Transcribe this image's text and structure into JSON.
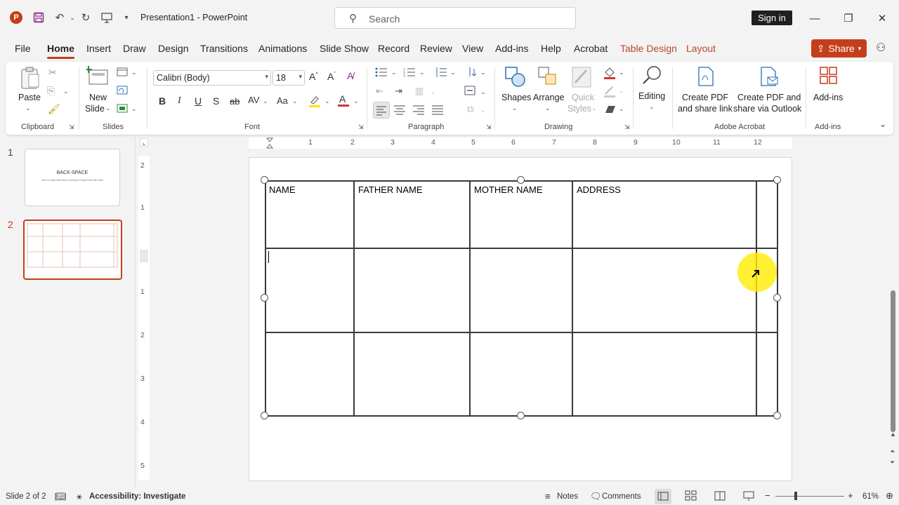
{
  "titlebar": {
    "app_letter": "P",
    "doc_title": "Presentation1  -  PowerPoint",
    "search_placeholder": "Search",
    "signin": "Sign in"
  },
  "tabs": [
    {
      "label": "File"
    },
    {
      "label": "Home"
    },
    {
      "label": "Insert"
    },
    {
      "label": "Draw"
    },
    {
      "label": "Design"
    },
    {
      "label": "Transitions"
    },
    {
      "label": "Animations"
    },
    {
      "label": "Slide Show"
    },
    {
      "label": "Record"
    },
    {
      "label": "Review"
    },
    {
      "label": "View"
    },
    {
      "label": "Add-ins"
    },
    {
      "label": "Help"
    },
    {
      "label": "Acrobat"
    },
    {
      "label": "Table Design"
    },
    {
      "label": "Layout"
    }
  ],
  "share_label": "Share",
  "ribbon": {
    "clipboard": {
      "paste": "Paste",
      "group": "Clipboard"
    },
    "slides": {
      "new_slide_1": "New",
      "new_slide_2": "Slide",
      "group": "Slides"
    },
    "font": {
      "font_name": "Calibri (Body)",
      "font_size": "18",
      "group": "Font",
      "bold": "B",
      "italic": "I",
      "underline": "U",
      "strike": "S",
      "abc": "ab",
      "spacing": "AV",
      "case": "Aa"
    },
    "paragraph": {
      "group": "Paragraph"
    },
    "drawing": {
      "shapes": "Shapes",
      "arrange": "Arrange",
      "quick_styles_1": "Quick",
      "quick_styles_2": "Styles",
      "group": "Drawing"
    },
    "editing": {
      "label": "Editing"
    },
    "acrobat": {
      "create_pdf_1": "Create PDF",
      "create_pdf_2": "and share link",
      "create_outlook_1": "Create PDF and",
      "create_outlook_2": "share via Outlook",
      "group": "Adobe Acrobat"
    },
    "addins": {
      "label": "Add-ins",
      "group": "Add-ins"
    }
  },
  "slides_pane": [
    {
      "number": "1",
      "title": "BACK-SPACE",
      "subtitle": "How to make table lines overlap in PowerPoint with ease"
    },
    {
      "number": "2"
    }
  ],
  "ruler": {
    "h_ticks": [
      "2",
      "1",
      "2",
      "3",
      "4",
      "5",
      "6",
      "7",
      "8",
      "9",
      "10",
      "11",
      "12"
    ],
    "v_ticks": [
      "2",
      "1",
      "1",
      "2",
      "3",
      "4",
      "5"
    ]
  },
  "table": {
    "headers": [
      "NAME",
      "FATHER NAME",
      "MOTHER NAME",
      "ADDRESS",
      ""
    ]
  },
  "statusbar": {
    "slide_info": "Slide 2 of 2",
    "accessibility": "Accessibility: Investigate",
    "notes": "Notes",
    "comments": "Comments",
    "zoom": "61%"
  },
  "colors": {
    "accent": "#c43e1c",
    "context_tab": "#b7472a"
  }
}
